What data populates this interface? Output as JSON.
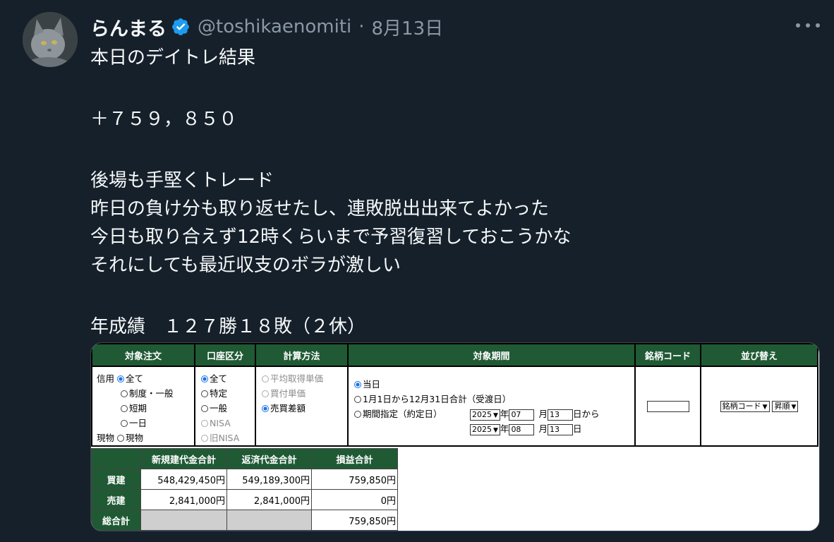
{
  "author": {
    "name": "らんまる",
    "handle": "@toshikaenomiti",
    "separator": "·",
    "date": "8月13日",
    "verified": true,
    "verified_color": "#1d9bf0"
  },
  "post": {
    "lines": [
      "本日のデイトレ結果",
      "",
      "＋７５９，８５０",
      "",
      "後場も手堅くトレード",
      "昨日の負け分も取り返せたし、連敗脱出出来てよかった",
      "今日も取り合えず12時くらいまで予習復習しておこうかな",
      "それにしても最近収支のボラが激しい",
      "",
      "年成績　１２７勝１８敗（２休）"
    ]
  },
  "card": {
    "header_color": "#1f5a34",
    "columns": [
      "対象注文",
      "口座区分",
      "計算方法",
      "対象期間",
      "銘柄コード",
      "並び替え"
    ],
    "order": {
      "credit_label": "信用",
      "credit_options": [
        "全て",
        "制度・一般",
        "短期",
        "一日"
      ],
      "credit_selected": "全て",
      "cash_label": "現物",
      "cash_options": [
        "現物"
      ]
    },
    "account": {
      "options": [
        "全て",
        "特定",
        "一般",
        "NISA",
        "旧NISA"
      ],
      "selected": "全て",
      "disabled": [
        "NISA",
        "旧NISA"
      ]
    },
    "calc": {
      "options": [
        "平均取得単価",
        "買付単価",
        "売買差額"
      ],
      "selected": "売買差額",
      "disabled": [
        "平均取得単価",
        "買付単価"
      ]
    },
    "period": {
      "opt_today": "当日",
      "opt_year": "1月1日から12月31日合計（受渡日）",
      "opt_range": "期間指定（約定日）",
      "selected": "当日",
      "from": {
        "year": "2025",
        "month": "07",
        "day": "13"
      },
      "to": {
        "year": "2025",
        "month": "08",
        "day": "13"
      },
      "year_suffix": "年",
      "month_suffix": "月",
      "day_suffix_from": "日から",
      "day_suffix_to": "日"
    },
    "code": {
      "value": ""
    },
    "sort": {
      "field": "銘柄コード",
      "order": "昇順"
    },
    "sums": {
      "headers": [
        "新規建代金合計",
        "返済代金合計",
        "損益合計"
      ],
      "rows": [
        {
          "label": "買建",
          "new": "548,429,450円",
          "repay": "549,189,300円",
          "pl": "759,850円"
        },
        {
          "label": "売建",
          "new": "2,841,000円",
          "repay": "2,841,000円",
          "pl": "0円"
        },
        {
          "label": "総合計",
          "new": "",
          "repay": "",
          "pl": "759,850円"
        }
      ]
    }
  }
}
